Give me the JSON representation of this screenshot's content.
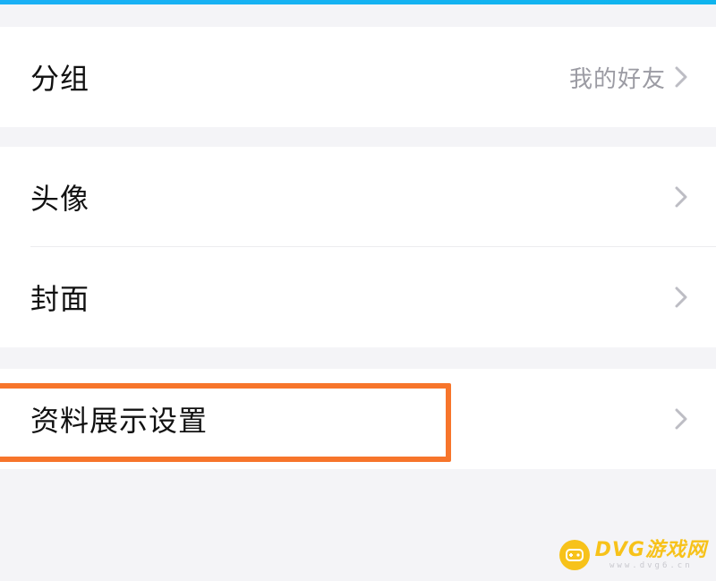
{
  "sections": [
    {
      "rows": [
        {
          "label": "分组",
          "value": "我的好友"
        }
      ]
    },
    {
      "rows": [
        {
          "label": "头像",
          "value": ""
        },
        {
          "label": "封面",
          "value": ""
        }
      ]
    },
    {
      "rows": [
        {
          "label": "资料展示设置",
          "value": ""
        }
      ]
    }
  ],
  "icons": {
    "chevron": "chevron-right-icon"
  },
  "colors": {
    "accent_bar": "#1ab0f5",
    "highlight": "#f7752b",
    "watermark": "#f7c21a",
    "chevron": "#bdbdc4",
    "secondary_text": "#9b9ba3"
  },
  "watermark": {
    "title": "DVG游戏网",
    "url": "www.dvg6.cn"
  }
}
